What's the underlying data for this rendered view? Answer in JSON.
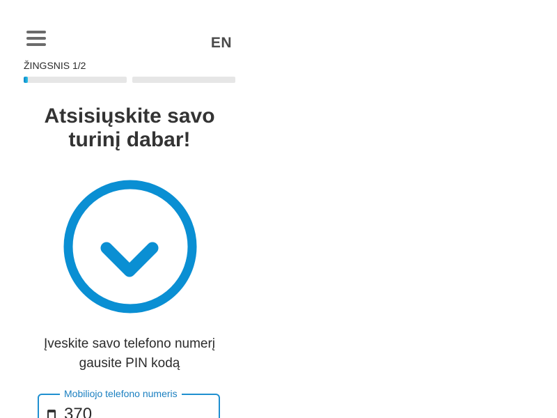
{
  "header": {
    "menu_icon": "hamburger-menu-icon",
    "language": "EN"
  },
  "progress": {
    "step_label": "ŽINGSNIS 1/2",
    "segments": [
      {
        "fill_fraction": 0.04
      },
      {
        "fill_fraction": 0.0
      }
    ]
  },
  "main": {
    "headline_line1": "Atsisiųskite savo",
    "headline_line2": "turinį dabar!",
    "hero_icon": "download-arrow-circle-icon",
    "instruction_line1": "Įveskite savo telefono numerį",
    "instruction_line2": "gausite PIN kodą"
  },
  "form": {
    "phone_label": "Mobiliojo telefono numeris",
    "phone_icon": "mobile-phone-icon",
    "phone_value": "370"
  },
  "colors": {
    "accent": "#0a8fd3",
    "accent_light": "#2cc3e8",
    "track": "#e6e6e6",
    "text": "#2b2b2b"
  }
}
